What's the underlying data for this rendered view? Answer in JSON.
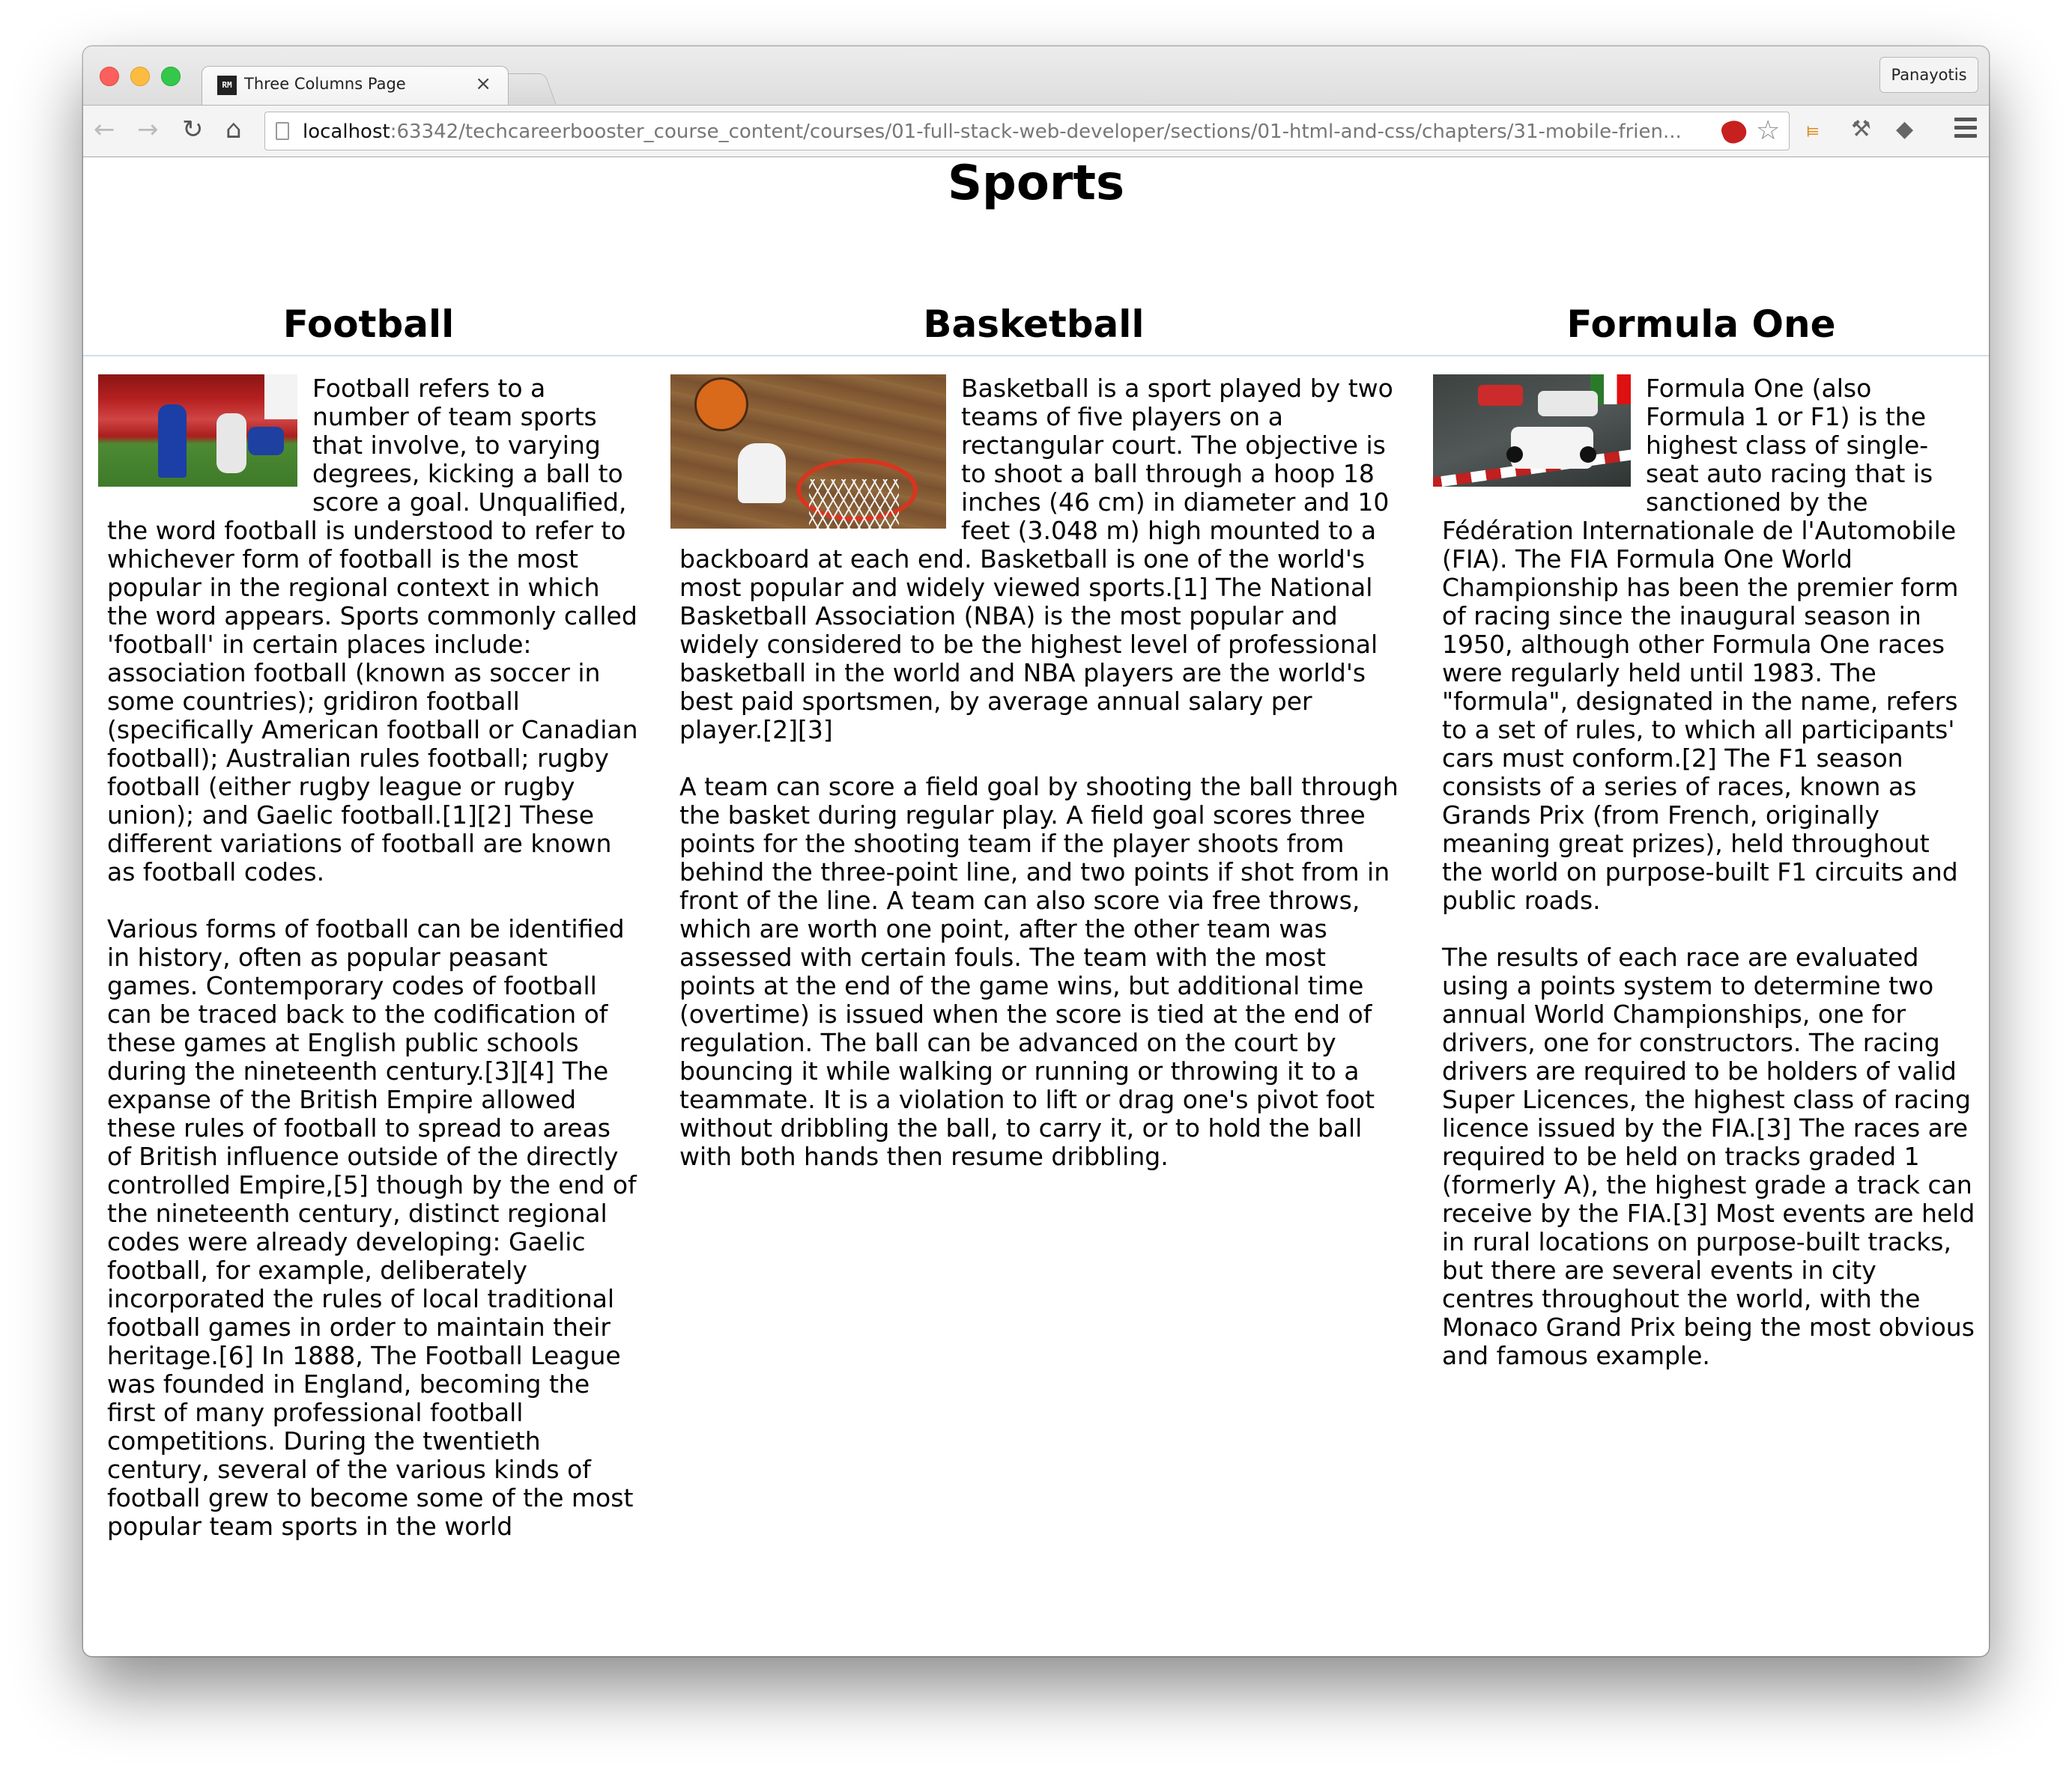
{
  "browser": {
    "tab_title": "Three Columns Page",
    "tab_favicon": "RM",
    "tab_close": "×",
    "profile": "Panayotis",
    "url_host": "localhost",
    "url_rest": ":63342/techcareerbooster_course_content/courses/01-full-stack-web-developer/sections/01-html-and-css/chapters/31-mobile-frien...",
    "icons": {
      "back": "back-arrow-icon",
      "forward": "forward-arrow-icon",
      "reload": "reload-icon",
      "home": "home-icon",
      "bookmark": "star-icon",
      "menu": "hamburger-menu-icon"
    }
  },
  "page": {
    "title": "Sports",
    "columns": [
      {
        "heading": "Football",
        "image": "football-image",
        "paragraphs": [
          "Football refers to a number of team sports that involve, to varying degrees, kicking a ball to score a goal. Unqualified, the word football is understood to refer to whichever form of football is the most popular in the regional context in which the word appears. Sports commonly called 'football' in certain places include: association football (known as soccer in some countries); gridiron football (specifically American football or Canadian football); Australian rules football; rugby football (either rugby league or rugby union); and Gaelic football.[1][2] These different variations of football are known as football codes.",
          "Various forms of football can be identified in history, often as popular peasant games. Contemporary codes of football can be traced back to the codification of these games at English public schools during the nineteenth century.[3][4] The expanse of the British Empire allowed these rules of football to spread to areas of British influence outside of the directly controlled Empire,[5] though by the end of the nineteenth century, distinct regional codes were already developing: Gaelic football, for example, deliberately incorporated the rules of local traditional football games in order to maintain their heritage.[6] In 1888, The Football League was founded in England, becoming the first of many professional football competitions. During the twentieth century, several of the various kinds of football grew to become some of the most popular team sports in the world"
        ]
      },
      {
        "heading": "Basketball",
        "image": "basketball-image",
        "paragraphs": [
          "Basketball is a sport played by two teams of five players on a rectangular court. The objective is to shoot a ball through a hoop 18 inches (46 cm) in diameter and 10 feet (3.048 m) high mounted to a backboard at each end. Basketball is one of the world's most popular and widely viewed sports.[1] The National Basketball Association (NBA) is the most popular and widely considered to be the highest level of professional basketball in the world and NBA players are the world's best paid sportsmen, by average annual salary per player.[2][3]",
          "A team can score a field goal by shooting the ball through the basket during regular play. A field goal scores three points for the shooting team if the player shoots from behind the three-point line, and two points if shot from in front of the line. A team can also score via free throws, which are worth one point, after the other team was assessed with certain fouls. The team with the most points at the end of the game wins, but additional time (overtime) is issued when the score is tied at the end of regulation. The ball can be advanced on the court by bouncing it while walking or running or throwing it to a teammate. It is a violation to lift or drag one's pivot foot without dribbling the ball, to carry it, or to hold the ball with both hands then resume dribbling."
        ]
      },
      {
        "heading": "Formula One",
        "image": "formula-one-image",
        "paragraphs": [
          "Formula One (also Formula 1 or F1) is the highest class of single-seat auto racing that is sanctioned by the Fédération Internationale de l'Automobile (FIA). The FIA Formula One World Championship has been the premier form of racing since the inaugural season in 1950, although other Formula One races were regularly held until 1983. The \"formula\", designated in the name, refers to a set of rules, to which all participants' cars must conform.[2] The F1 season consists of a series of races, known as Grands Prix (from French, originally meaning great prizes), held throughout the world on purpose-built F1 circuits and public roads.",
          "The results of each race are evaluated using a points system to determine two annual World Championships, one for drivers, one for constructors. The racing drivers are required to be holders of valid Super Licences, the highest class of racing licence issued by the FIA.[3] The races are required to be held on tracks graded 1 (formerly A), the highest grade a track can receive by the FIA.[3] Most events are held in rural locations on purpose-built tracks, but there are several events in city centres throughout the world, with the Monaco Grand Prix being the most obvious and famous example."
        ]
      }
    ]
  }
}
